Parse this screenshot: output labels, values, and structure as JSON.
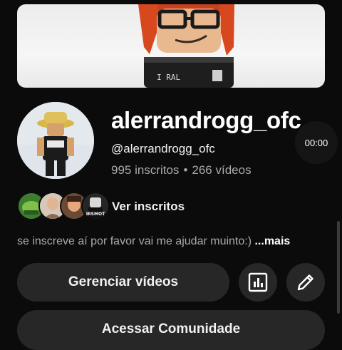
{
  "channel": {
    "name": "alerrandrogg_ofc",
    "handle": "@alerrandrogg_ofc",
    "subscribers": "995 inscritos",
    "separator": "•",
    "videos": "266 vídeos",
    "description": "se inscreve aí por favor vai me ajudar muinto:)",
    "more_label": "...mais"
  },
  "video_time": "00:00",
  "subscribers_row": {
    "label": "Ver inscritos",
    "avatars": [
      "subscriber-avatar-1",
      "subscriber-avatar-2",
      "subscriber-avatar-3",
      "subscriber-avatar-4"
    ],
    "avatar_text": "IRSMOT"
  },
  "buttons": {
    "manage_videos": "Gerenciar vídeos",
    "analytics_icon": "bar-chart-icon",
    "edit_icon": "pencil-icon",
    "community": "Acessar Comunidade"
  },
  "colors": {
    "background": "#0b0b0b",
    "button_bg": "#272727",
    "secondary_text": "#aaaaaa"
  }
}
